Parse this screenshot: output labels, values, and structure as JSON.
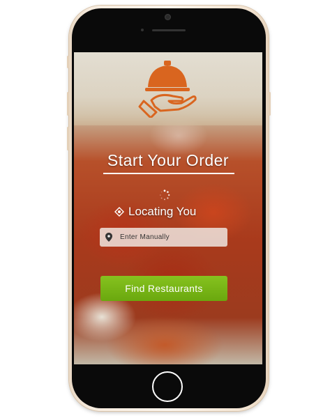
{
  "app": {
    "title": "Start Your Order",
    "status": "Locating You",
    "search": {
      "placeholder": "Enter Manually"
    },
    "primary_button": "Find Restaurants"
  },
  "icons": {
    "logo": "cloche-hand-icon",
    "spinner": "loading-spinner-icon",
    "location": "location-target-icon",
    "pin": "map-pin-icon"
  },
  "colors": {
    "logo": "#d9651f",
    "button": "#7ab518",
    "text": "#ffffff"
  }
}
